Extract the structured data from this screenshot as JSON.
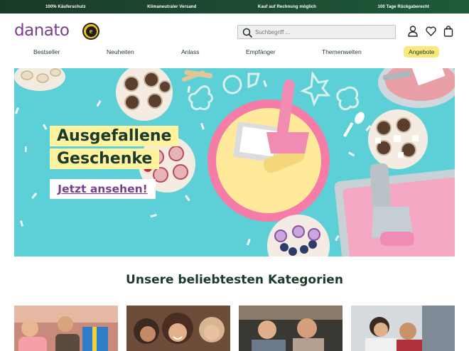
{
  "topbar": {
    "items": [
      "100% Käuferschutz",
      "Klimaneutraler Versand",
      "Kauf auf Rechnung möglich",
      "100 Tage Rückgaberecht"
    ]
  },
  "header": {
    "logo": "danato",
    "trust_badge": "e",
    "search_placeholder": "Suchbegriff ..."
  },
  "nav": {
    "items": [
      "Bestseller",
      "Neuheiten",
      "Anlass",
      "Empfänger",
      "Themenwelten"
    ],
    "offer": "Angebote"
  },
  "hero": {
    "headline_1": "Ausgefallene",
    "headline_2": "Geschenke",
    "cta": "Jetzt ansehen!"
  },
  "categories": {
    "title": "Unsere beliebtesten Kategorien",
    "cards": [
      "category-card-1",
      "category-card-2",
      "category-card-3",
      "category-card-4"
    ]
  },
  "colors": {
    "brand": "#7a3f8c",
    "topbar": "#1f5a3a",
    "hero_bg": "#5cd0d6",
    "highlight": "#fff3a0",
    "offer_badge": "#fbe77a"
  },
  "icons": [
    "search-icon",
    "user-icon",
    "heart-icon",
    "bag-icon",
    "trusted-shops-icon"
  ]
}
